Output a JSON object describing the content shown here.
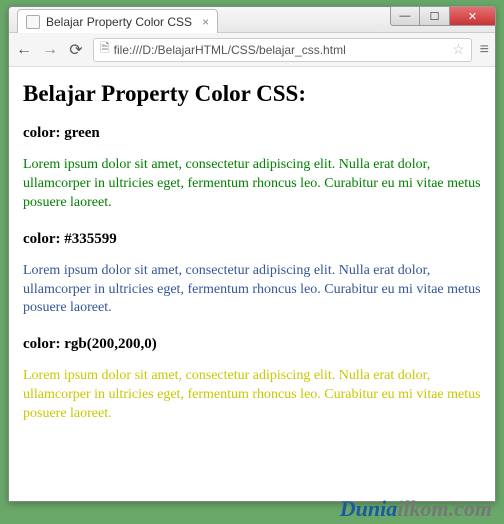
{
  "window": {
    "tab_title": "Belajar Property Color CSS",
    "url": "file:///D:/BelajarHTML/CSS/belajar_css.html"
  },
  "page": {
    "heading": "Belajar Property Color CSS:",
    "sections": [
      {
        "label": "color: green",
        "text": "Lorem ipsum dolor sit amet, consectetur adipiscing elit. Nulla erat dolor, ullamcorper in ultricies eget, fermentum rhoncus leo. Curabitur eu mi vitae metus posuere laoreet."
      },
      {
        "label": "color: #335599",
        "text": "Lorem ipsum dolor sit amet, consectetur adipiscing elit. Nulla erat dolor, ullamcorper in ultricies eget, fermentum rhoncus leo. Curabitur eu mi vitae metus posuere laoreet."
      },
      {
        "label": "color: rgb(200,200,0)",
        "text": "Lorem ipsum dolor sit amet, consectetur adipiscing elit. Nulla erat dolor, ullamcorper in ultricies eget, fermentum rhoncus leo. Curabitur eu mi vitae metus posuere laoreet."
      }
    ]
  },
  "watermark": {
    "part1": "Dunia",
    "part2": "ilkom.com"
  }
}
